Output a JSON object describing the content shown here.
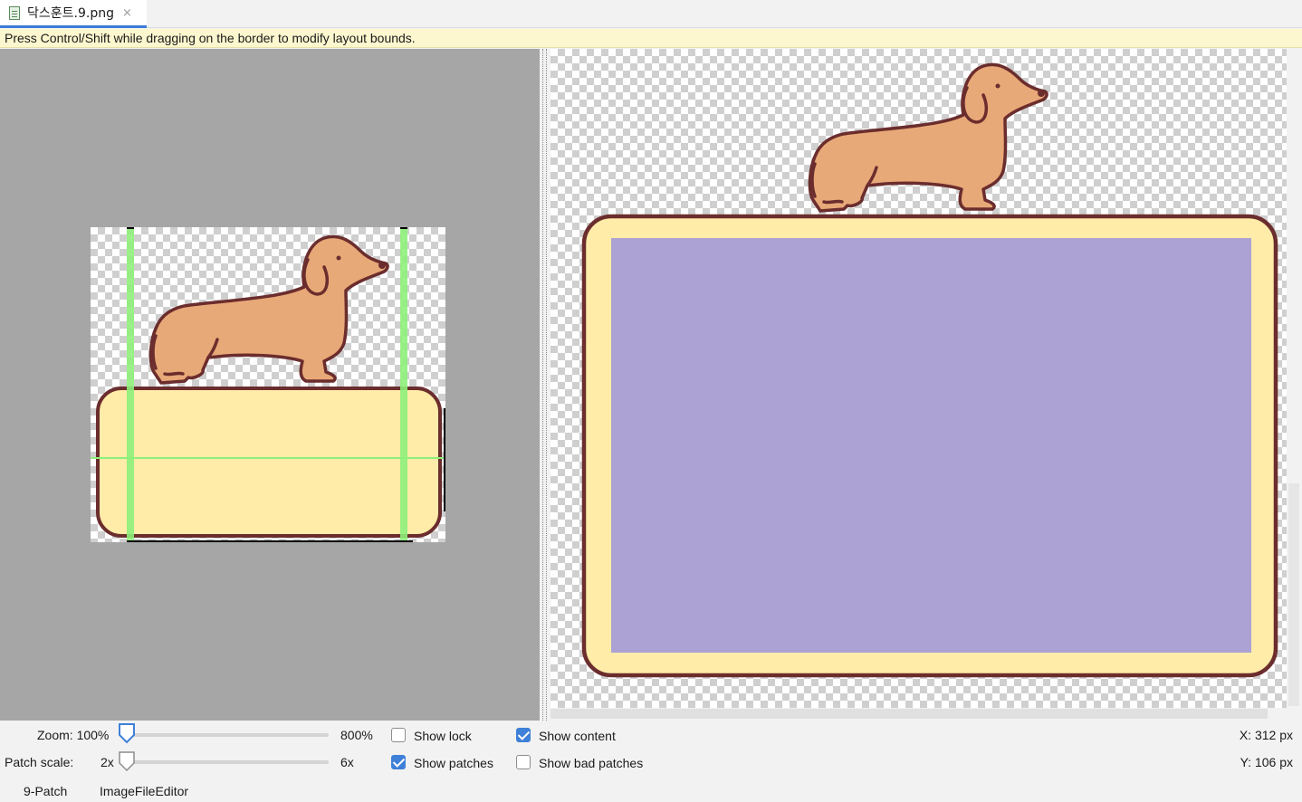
{
  "tab": {
    "title": "닥스훈트.9.png",
    "close_glyph": "×",
    "icon": "image-file-icon"
  },
  "hint": "Press Control/Shift while dragging on the border to modify layout bounds.",
  "controls": {
    "zoom_label": "Zoom: 100%",
    "zoom_max": "800%",
    "patch_scale_label": "Patch scale:",
    "patch_scale_min": "2x",
    "patch_scale_max": "6x",
    "show_lock": {
      "label": "Show lock",
      "checked": false
    },
    "show_patches": {
      "label": "Show patches",
      "checked": true
    },
    "show_content": {
      "label": "Show content",
      "checked": true
    },
    "show_bad_patches": {
      "label": "Show bad patches",
      "checked": false
    },
    "x_readout": "X: 312 px",
    "y_readout": "Y: 106 px"
  },
  "bottom_tabs": [
    {
      "label": "9-Patch"
    },
    {
      "label": "ImageFileEditor"
    }
  ],
  "colors": {
    "accent": "#3f80d8",
    "patch_guide": "#8ef07a",
    "content_area": "#ada2d4",
    "dog_fill": "#e8a978",
    "outline": "#6b2d2d",
    "box_fill": "#ffeca8",
    "hint_bg": "#fdf7cf"
  }
}
